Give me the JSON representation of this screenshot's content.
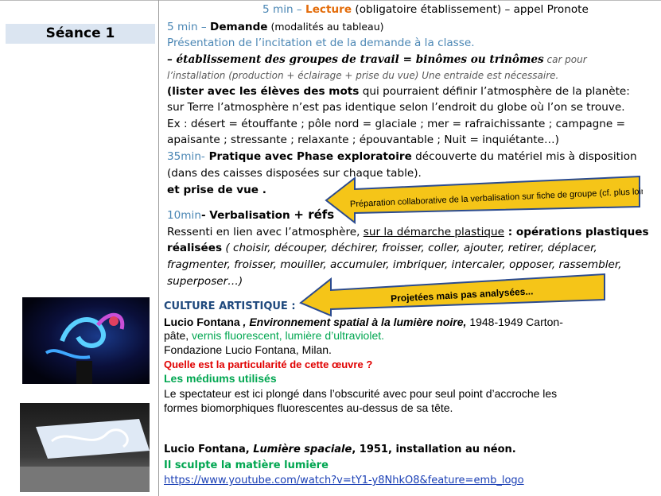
{
  "seance": "Séance 1",
  "l1": {
    "a": "5 min – ",
    "b": "Lecture",
    "c": " (obligatoire établissement) – appel Pronote"
  },
  "l2": {
    "a": "5 min – ",
    "b": "Demande",
    "c": " (modalités au tableau)"
  },
  "l3": "Présentation de l’incitation et de la demande à la classe.",
  "l4": {
    "a": "– ",
    "b": "établissement des groupes de travail = binômes ou trinômes",
    "c": "  car pour"
  },
  "l5": "l’installation (production + éclairage + prise du vue) Une entraide est nécessaire.",
  "l6": {
    "a": "(lister avec les élèves des mots",
    "b": " qui pourraient définir l’atmosphère de la planète:"
  },
  "l7": "sur Terre l’atmosphère n’est pas identique selon l’endroit du globe où l’on se trouve.",
  "l8": "Ex : désert = étouffante ; pôle nord = glaciale ; mer = rafraichissante  ;  campagne =",
  "l9": "apaisante ; stressante ; relaxante ; épouvantable ; Nuit = inquiétante…)",
  "l10": {
    "a": "35min-",
    "b": " Pratique avec Phase exploratoire",
    "c": "  découverte du matériel mis à disposition"
  },
  "l11": "(dans des caisses disposées sur chaque table).",
  "l12": "et prise de vue .",
  "l13": {
    "a": "10min",
    "b": "- Verbalisation ",
    "c": " + réfs"
  },
  "l14": {
    "a": "Ressenti en lien avec l’atmosphère, ",
    "b": "sur la démarche plastique",
    "c": " : opérations plastiques"
  },
  "l15": {
    "a": "réalisées",
    "b": " ( choisir, découper, déchirer, froisser, coller, ajouter, retirer, déplacer,"
  },
  "l16": "fragmenter, froisser, mouiller, accumuler, imbriquer, intercaler, opposer, rassembler,",
  "l17": "superposer…)",
  "arrow1": "Préparation collaborative de la verbalisation sur fiche de groupe (cf. plus loin)",
  "arrow2": "Projetées mais pas analysées...",
  "culture": "CULTURE ARTISTIQUE :",
  "c1": {
    "a": "Lucio Fontana",
    "b": " , Environnement spatial à la lumière noire,",
    "c": " 1948-1949 Carton-"
  },
  "c2": {
    "a": "pâte,",
    "b": " vernis fluorescent,  lumière d’ultraviolet."
  },
  "c3": " Fondazione Lucio Fontana, Milan.",
  "c4": "Quelle est la particularité  de cette œuvre ?",
  "c5": "Les médiums  utilisés",
  "c6": "Le spectateur est ici plongé dans l’obscurité avec pour seul point d’accroche les",
  "c7": "formes biomorphiques fluorescentes au-dessus de sa tête.",
  "c8": {
    "a": "Lucio Fontana, ",
    "b": "Lumière spaciale",
    "c": ", 1951, installation  au néon."
  },
  "c9": "Il sculpte la matière lumière",
  "c10": "https://www.youtube.com/watch?v=tY1-y8NhkO8&feature=emb_logo",
  "colors": {
    "seance_bg": "#dbe5f1",
    "blue": "#4a86b4",
    "orange": "#e36c0a",
    "green": "#00a650",
    "red": "#e00000",
    "arrow": "#f5c518"
  }
}
